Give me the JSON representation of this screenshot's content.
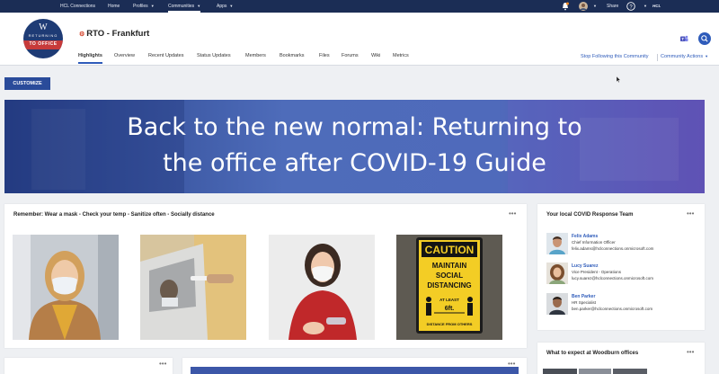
{
  "topbar": {
    "items": [
      {
        "label": "HCL Connections"
      },
      {
        "label": "Home"
      },
      {
        "label": "Profiles"
      },
      {
        "label": "Communities"
      },
      {
        "label": "Apps"
      }
    ],
    "share_label": "Share",
    "brand": "HCL"
  },
  "community": {
    "logo_top": "RETURNING",
    "logo_bottom": "TO OFFICE",
    "logo_letter": "W",
    "name": "RTO - Frankfurt"
  },
  "tabs": [
    {
      "label": "Highlights"
    },
    {
      "label": "Overview"
    },
    {
      "label": "Recent Updates"
    },
    {
      "label": "Status Updates"
    },
    {
      "label": "Members"
    },
    {
      "label": "Bookmarks"
    },
    {
      "label": "Files"
    },
    {
      "label": "Forums"
    },
    {
      "label": "Wiki"
    },
    {
      "label": "Metrics"
    }
  ],
  "header_actions": {
    "stop_following": "Stop Following this Community",
    "community_actions": "Community Actions"
  },
  "customize_label": "CUSTOMIZE",
  "banner": {
    "line1": "Back to the new normal: Returning to",
    "line2": "the office after COVID-19 Guide"
  },
  "reminder_card": {
    "title": "Remember: Wear a mask - Check your temp - Sanitize often - Socially distance",
    "sign_lines": [
      "CAUTION",
      "MAINTAIN",
      "SOCIAL",
      "DISTANCING",
      "AT LEAST",
      "6ft.",
      "DISTANCE FROM OTHERS"
    ]
  },
  "team_card": {
    "title": "Your local COVID Response Team",
    "members": [
      {
        "name": "Felix Adams",
        "role": "Chief Information Officer",
        "email": "felix.adams@hclconnections.onmicrosoft.com"
      },
      {
        "name": "Lucy Suarez",
        "role": "Vice President - Operations",
        "email": "lucy.suarez@hclconnections.onmicrosoft.com"
      },
      {
        "name": "Ben Parker",
        "role": "HR Specialist",
        "email": "ben.parker@hclconnections.onmicrosoft.com"
      }
    ]
  },
  "expect_card": {
    "title": "What to expect at Woodburn offices"
  },
  "more_glyph": "•••",
  "colors": {
    "topbar": "#1b2d55",
    "accent": "#2e5bba",
    "button": "#2a4b9a",
    "banner_start": "#263f86",
    "banner_end": "#5b4fb0"
  }
}
